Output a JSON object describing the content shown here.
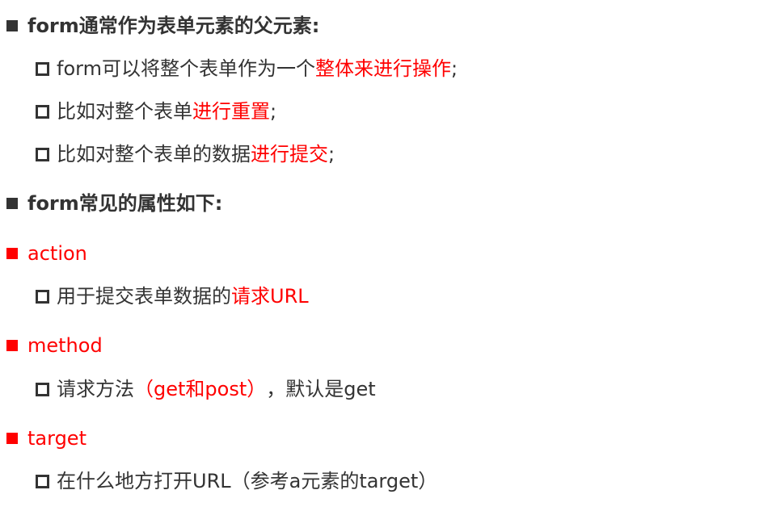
{
  "colors": {
    "text": "#333333",
    "accent": "#ff0000",
    "background": "#ffffff"
  },
  "sections": [
    {
      "heading": "form通常作为表单元素的父元素:",
      "items": [
        {
          "parts": [
            "form可以将整个表单作为一个",
            "整体来进行操作",
            ";"
          ]
        },
        {
          "parts": [
            "比如对整个表单",
            "进行重置",
            ";"
          ]
        },
        {
          "parts": [
            "比如对整个表单的数据",
            "进行提交",
            ";"
          ]
        }
      ]
    },
    {
      "heading": "form常见的属性如下:"
    },
    {
      "attribute": "action",
      "items": [
        {
          "parts": [
            "用于提交表单数据的",
            "请求URL"
          ]
        }
      ]
    },
    {
      "attribute": "method",
      "items": [
        {
          "parts": [
            "请求方法",
            "（get和post）",
            "，默认是get"
          ]
        }
      ]
    },
    {
      "attribute": "target",
      "items": [
        {
          "parts": [
            "在什么地方打开URL（参考a元素的target）"
          ]
        }
      ]
    }
  ]
}
